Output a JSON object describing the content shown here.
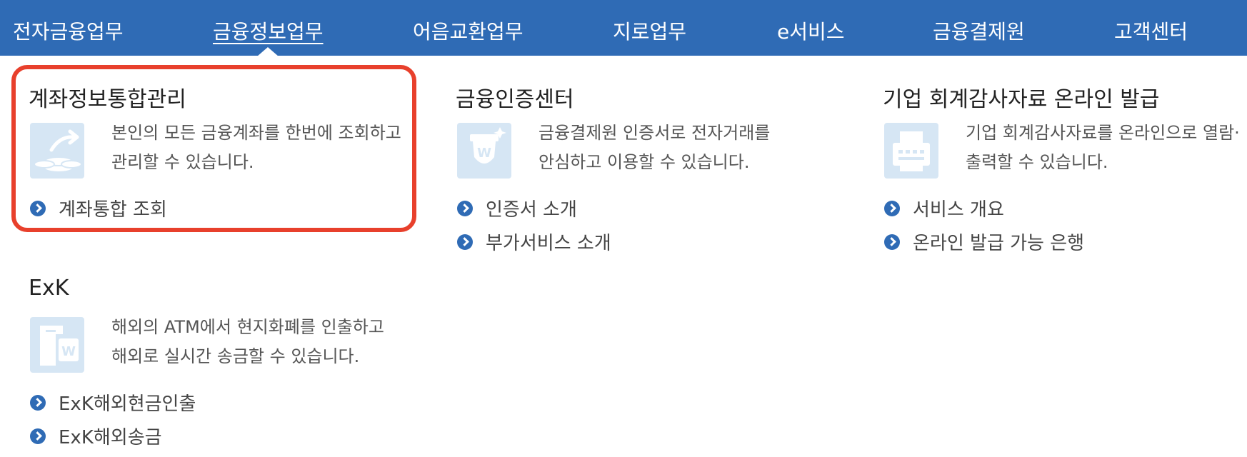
{
  "nav": {
    "items": [
      {
        "label": "전자금융업무"
      },
      {
        "label": "금융정보업무",
        "active": true
      },
      {
        "label": "어음교환업무"
      },
      {
        "label": "지로업무"
      },
      {
        "label": "e서비스"
      },
      {
        "label": "금융결제원"
      },
      {
        "label": "고객센터"
      }
    ]
  },
  "sections": [
    {
      "title": "계좌정보통합관리",
      "icon": "coins-transfer-icon",
      "desc": [
        "본인의 모든 금융계좌를 한번에 조회하고",
        "관리할 수 있습니다."
      ],
      "links": [
        "계좌통합 조회"
      ],
      "highlighted": true
    },
    {
      "title": "금융인증센터",
      "icon": "certificate-icon",
      "desc": [
        "금융결제원 인증서로 전자거래를",
        "안심하고 이용할 수 있습니다."
      ],
      "links": [
        "인증서 소개",
        "부가서비스 소개"
      ]
    },
    {
      "title": "기업 회계감사자료 온라인 발급",
      "icon": "printer-icon",
      "desc": [
        "기업 회계감사자료를 온라인으로 열람·",
        "출력할 수 있습니다."
      ],
      "links": [
        "서비스 개요",
        "온라인 발급 가능 은행"
      ]
    },
    {
      "title": "ExK",
      "icon": "atm-icon",
      "desc": [
        "해외의 ATM에서 현지화폐를 인출하고",
        "해외로 실시간 송금할 수 있습니다."
      ],
      "links": [
        "ExK해외현금인출",
        "ExK해외송금"
      ]
    }
  ],
  "colors": {
    "nav_bg": "#2f6bb5",
    "bullet": "#2f6bb5",
    "icon_bg": "#d6e6f4",
    "highlight_border": "#e8402c"
  }
}
